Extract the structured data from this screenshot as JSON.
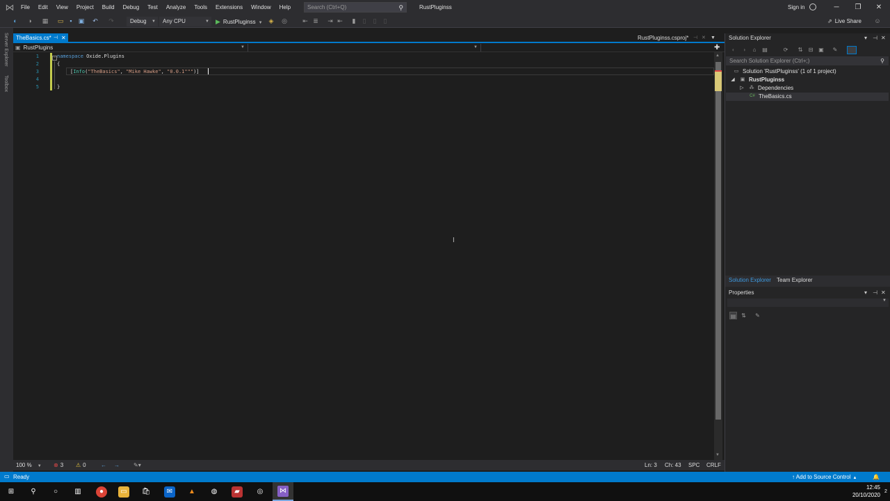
{
  "titlebar": {
    "menu": [
      "File",
      "Edit",
      "View",
      "Project",
      "Build",
      "Debug",
      "Test",
      "Analyze",
      "Tools",
      "Extensions",
      "Window",
      "Help"
    ],
    "search_placeholder": "Search (Ctrl+Q)",
    "solution_name": "RustPluginss",
    "sign_in": "Sign in"
  },
  "toolbar": {
    "configuration": "Debug",
    "platform": "Any CPU",
    "start_target": "RustPluginss",
    "live_share": "Live Share"
  },
  "siderail": {
    "items": [
      "Server Explorer",
      "Toolbox"
    ]
  },
  "doc_tabs": {
    "active": "TheBasics.cs*",
    "project": "RustPluginss.csproj*"
  },
  "navbar": {
    "project": "RustPlugins"
  },
  "editor": {
    "line_numbers": [
      "1",
      "2",
      "3",
      "4",
      "5"
    ],
    "l1_kw": "namespace",
    "l1_rest": " Oxide.Plugins",
    "l2": "{",
    "l3_open": "[",
    "l3_type": "Info",
    "l3_paren": "(",
    "l3_s1": "\"TheBasics\"",
    "l3_c1": ", ",
    "l3_s2": "\"Mike Hawke\"",
    "l3_c2": ", ",
    "l3_s3": "\"0.0.1\"",
    "l3_s4": "\"\"",
    "l3_close": ")]",
    "l5": "}"
  },
  "editor_status": {
    "zoom": "100 %",
    "errors": "3",
    "warnings": "0",
    "line": "Ln: 3",
    "col": "Ch: 43",
    "spc": "SPC",
    "eol": "CRLF"
  },
  "solution_explorer": {
    "title": "Solution Explorer",
    "search_placeholder": "Search Solution Explorer (Ctrl+;)",
    "solution_label": "Solution 'RustPluginss' (1 of 1 project)",
    "project": "RustPluginss",
    "dependencies": "Dependencies",
    "file": "TheBasics.cs",
    "tabs": [
      "Solution Explorer",
      "Team Explorer"
    ]
  },
  "properties": {
    "title": "Properties"
  },
  "statusbar": {
    "status": "Ready",
    "source_control": "Add to Source Control"
  },
  "taskbar": {
    "time": "12:45",
    "date": "20/10/2020",
    "notification_count": "2"
  },
  "colors": {
    "accent": "#007acc",
    "keyword": "#569cd6",
    "string": "#d69d85",
    "type": "#4ec9b0",
    "line_number": "#2b91af",
    "change_bar": "#c4cc4d"
  }
}
